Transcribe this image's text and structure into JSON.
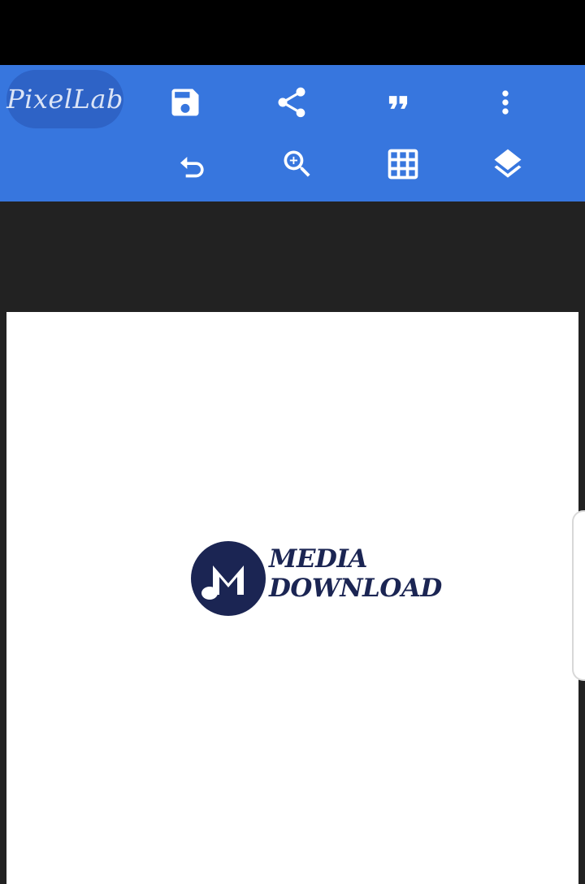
{
  "app": {
    "logo_text": "PixelLab"
  },
  "toolbar": {
    "row1": [
      {
        "icon": "plus-icon"
      },
      {
        "icon": "save-icon"
      },
      {
        "icon": "share-icon"
      },
      {
        "icon": "quote-icon"
      },
      {
        "icon": "more-vertical-icon"
      }
    ],
    "row2": [
      {
        "icon": "undo-icon"
      },
      {
        "icon": "zoom-in-icon"
      },
      {
        "icon": "grid-icon"
      },
      {
        "icon": "layers-icon"
      }
    ]
  },
  "canvas": {
    "logo_line1": "MEDIA",
    "logo_line2": "DOWNLOAD"
  },
  "colors": {
    "toolbar": "#3776DE",
    "toolbar_logo_pill": "#2E63C6",
    "workspace": "#222222",
    "page": "#FFFFFF",
    "brand_navy": "#1B2553"
  }
}
